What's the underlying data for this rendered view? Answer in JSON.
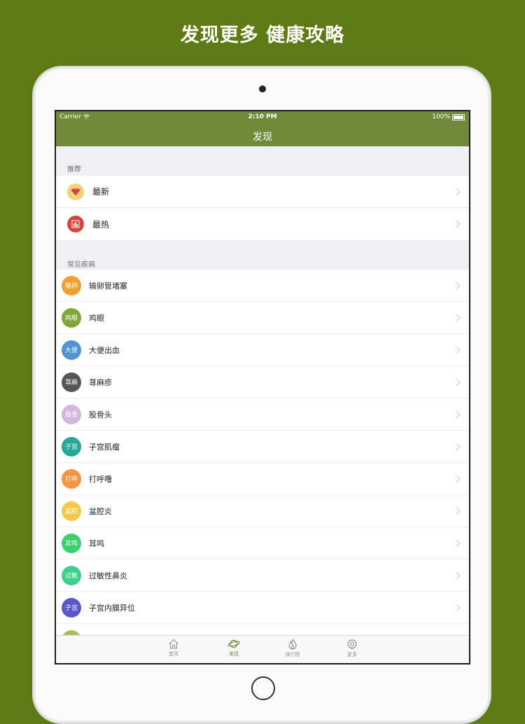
{
  "headline": "发现更多 健康攻略",
  "status": {
    "carrier": "Carrier",
    "time": "2:10 PM",
    "battery": "100%"
  },
  "nav": {
    "title": "发现"
  },
  "recommend": {
    "header": "推荐",
    "items": [
      {
        "label": "最新",
        "icon": "gem-icon",
        "bg": "#f4d27a",
        "fg": "#d9413a"
      },
      {
        "label": "最热",
        "icon": "bar-chart-icon",
        "bg": "#d9443a",
        "fg": "#ffffff"
      }
    ]
  },
  "diseases": {
    "header": "常见疾病",
    "items": [
      {
        "badge": "输卵",
        "label": "输卵管堵塞",
        "color": "#f0a030"
      },
      {
        "badge": "鸡眼",
        "label": "鸡眼",
        "color": "#7fa83a"
      },
      {
        "badge": "大便",
        "label": "大便出血",
        "color": "#4f93d1"
      },
      {
        "badge": "荨麻",
        "label": "荨麻疹",
        "color": "#555555"
      },
      {
        "badge": "股骨",
        "label": "股骨头",
        "color": "#d3b6df"
      },
      {
        "badge": "子宫",
        "label": "子宫肌瘤",
        "color": "#27a89a"
      },
      {
        "badge": "打呼",
        "label": "打呼噜",
        "color": "#f29440"
      },
      {
        "badge": "盆腔",
        "label": "盆腔炎",
        "color": "#f5c74a"
      },
      {
        "badge": "耳鸣",
        "label": "耳鸣",
        "color": "#3fcf6e"
      },
      {
        "badge": "过敏",
        "label": "过敏性鼻炎",
        "color": "#3fcf88"
      },
      {
        "badge": "子宫",
        "label": "子宫内膜异位",
        "color": "#5a58c8"
      },
      {
        "badge": "",
        "label": "",
        "color": "#a7c25c"
      }
    ]
  },
  "tabs": [
    {
      "label": "首页",
      "icon": "home-icon",
      "active": false
    },
    {
      "label": "发现",
      "icon": "planet-icon",
      "active": true
    },
    {
      "label": "排行榜",
      "icon": "flame-icon",
      "active": false
    },
    {
      "label": "更多",
      "icon": "gear-icon",
      "active": false
    }
  ]
}
